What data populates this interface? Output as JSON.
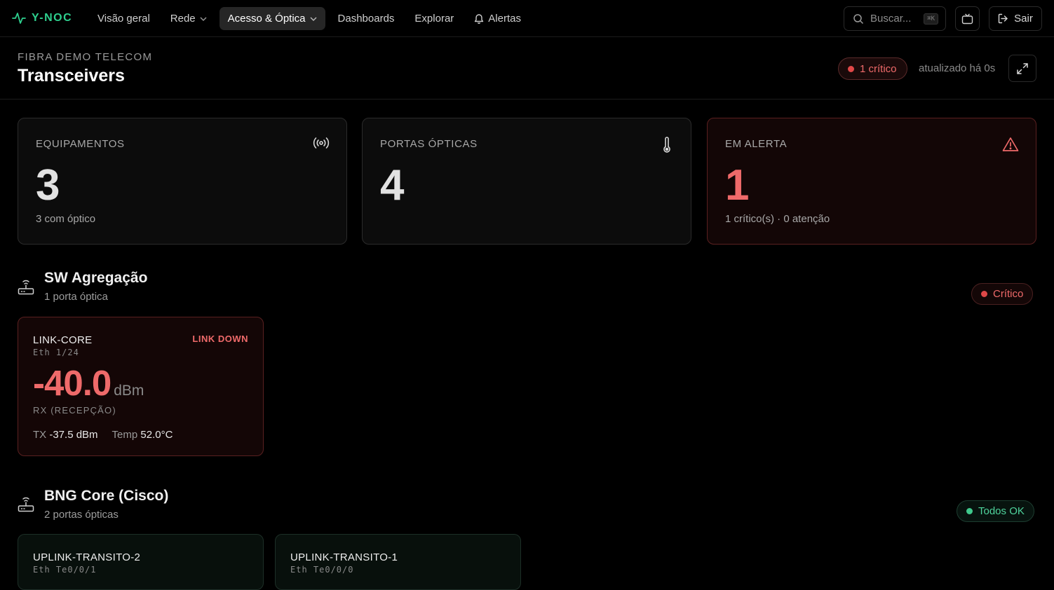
{
  "brand": {
    "name": "Y-NOC"
  },
  "nav": {
    "items": [
      {
        "label": "Visão geral"
      },
      {
        "label": "Rede"
      },
      {
        "label": "Acesso & Óptica"
      },
      {
        "label": "Dashboards"
      },
      {
        "label": "Explorar"
      },
      {
        "label": "Alertas"
      }
    ],
    "search_placeholder": "Buscar...",
    "search_shortcut": "⌘K",
    "logout_label": "Sair"
  },
  "header": {
    "org": "FIBRA DEMO TELECOM",
    "title": "Transceivers",
    "critical_badge": "1 crítico",
    "updated": "atualizado há 0s"
  },
  "stats": [
    {
      "label": "EQUIPAMENTOS",
      "value": "3",
      "sub": "3 com óptico",
      "icon": "broadcast-icon"
    },
    {
      "label": "PORTAS ÓPTICAS",
      "value": "4",
      "sub": "",
      "icon": "thermometer-icon"
    },
    {
      "label": "EM ALERTA",
      "value": "1",
      "sub": "1 crítico(s) · 0 atenção",
      "icon": "warning-icon"
    }
  ],
  "devices": [
    {
      "name": "SW Agregação",
      "ports_count": "1 porta óptica",
      "status": "Crítico",
      "ports": [
        {
          "name": "LINK-CORE",
          "interface": "Eth 1/24",
          "status": "LINK DOWN",
          "rx_value": "-40.0",
          "rx_unit": "dBm",
          "rx_label": "RX (RECEPÇÃO)",
          "tx_label": "TX",
          "tx_value": "-37.5 dBm",
          "temp_label": "Temp",
          "temp_value": "52.0°C"
        }
      ]
    },
    {
      "name": "BNG Core (Cisco)",
      "ports_count": "2 portas ópticas",
      "status": "Todos OK",
      "ports": [
        {
          "name": "UPLINK-TRANSITO-2",
          "interface": "Eth Te0/0/1"
        },
        {
          "name": "UPLINK-TRANSITO-1",
          "interface": "Eth Te0/0/0"
        }
      ]
    }
  ],
  "colors": {
    "brand": "#2ecf8e",
    "critical": "#ef6a6a",
    "ok": "#4fd39c",
    "background": "#000000"
  }
}
